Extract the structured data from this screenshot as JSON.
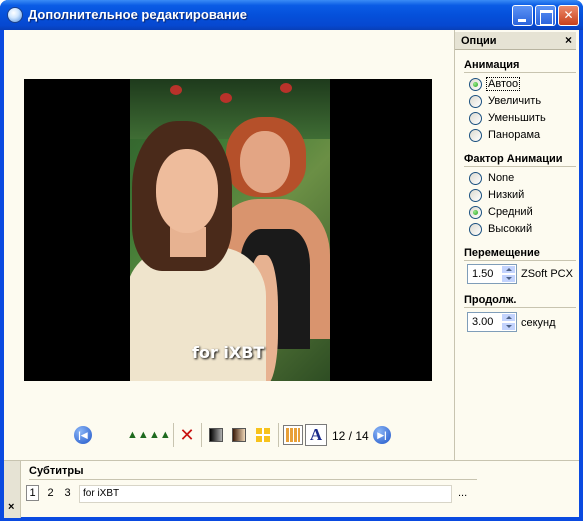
{
  "window": {
    "title": "Дополнительное редактирование"
  },
  "preview": {
    "watermark": "for iXBT"
  },
  "toolbar": {
    "icons": [
      "first-slide-icon",
      "mountains-left-icon",
      "mountains-right-icon",
      "delete-icon",
      "fade-black-icon",
      "fade-sepia-icon",
      "cross-icon",
      "film-strip-icon",
      "font-icon",
      "next-slide-icon"
    ],
    "font_glyph": "A",
    "counter": "12 / 14"
  },
  "options": {
    "header": "Опции",
    "close": "×",
    "animation": {
      "title": "Анимация",
      "items": [
        "Автоо",
        "Увеличить",
        "Уменьшить",
        "Панорама"
      ],
      "selected": "Автоо"
    },
    "factor": {
      "title": "Фактор Анимации",
      "items": [
        "None",
        "Низкий",
        "Средний",
        "Высокий"
      ],
      "selected": "Средний"
    },
    "transition": {
      "title": "Перемещение",
      "value": "1.50",
      "unit": "ZSoft PCX и"
    },
    "duration": {
      "title": "Продолж.",
      "value": "3.00",
      "unit": "секунд"
    }
  },
  "subtitles": {
    "title": "Субтитры",
    "close": "×",
    "numbers": [
      "1",
      "2",
      "3"
    ],
    "active_number": "1",
    "text": "for iXBT",
    "more": "..."
  },
  "colors": {
    "titlebar": "#0550db",
    "frame_border": "#0a4ae0",
    "window_bg": "#fdfbf0",
    "radio_checked": "#21a121"
  }
}
